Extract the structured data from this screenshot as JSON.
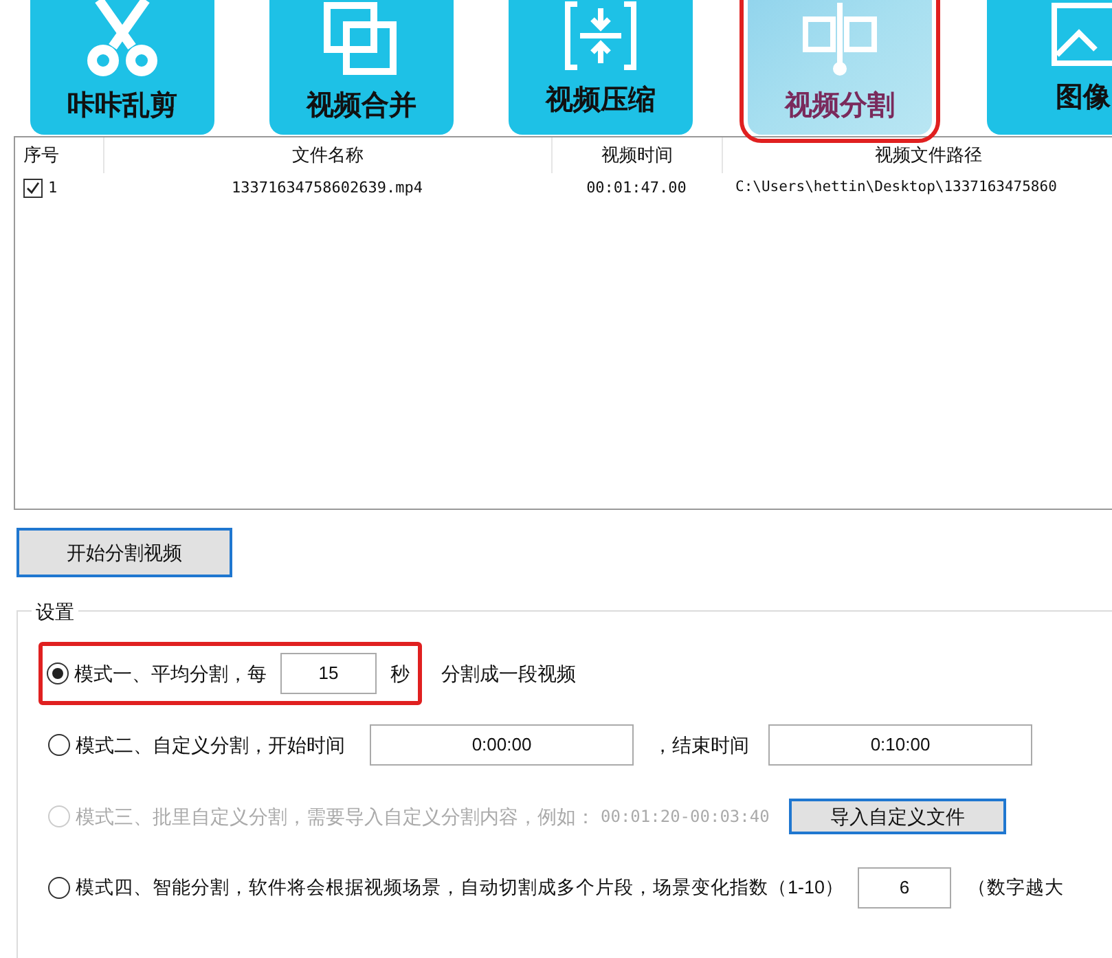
{
  "toolbar": [
    {
      "label": "咔咔乱剪",
      "kind": "scissors",
      "selected": false
    },
    {
      "label": "视频合并",
      "kind": "merge",
      "selected": false
    },
    {
      "label": "视频压缩",
      "kind": "compress",
      "selected": false
    },
    {
      "label": "视频分割",
      "kind": "split",
      "selected": true
    },
    {
      "label": "图像",
      "kind": "image",
      "selected": false
    }
  ],
  "table": {
    "columns": [
      "序号",
      "文件名称",
      "视频时间",
      "视频文件路径"
    ],
    "rows": [
      {
        "checked": true,
        "cells": [
          "1",
          "13371634758602639.mp4",
          "00:01:47.00",
          "C:\\Users\\hettin\\Desktop\\1337163475860"
        ]
      }
    ]
  },
  "start_button": "开始分割视频",
  "settings": {
    "title": "设置",
    "modes": [
      {
        "kind": "seconds",
        "selected": true,
        "disabled": false,
        "highlighted": true,
        "label": "模式一、平均分割，每",
        "value": "15",
        "unit": "秒",
        "suffix": "分割成一段视频"
      },
      {
        "kind": "range",
        "selected": false,
        "disabled": false,
        "highlighted": false,
        "label": "模式二、自定义分割，开始时间",
        "start": "0:00:00",
        "mid": "，结束时间",
        "end": "0:10:00"
      },
      {
        "kind": "import",
        "selected": false,
        "disabled": true,
        "highlighted": false,
        "label": "模式三、批里自定义分割，需要导入自定义分割内容，例如：",
        "example": "00:01:20-00:03:40",
        "button": "导入自定义文件"
      },
      {
        "kind": "smart",
        "selected": false,
        "disabled": false,
        "highlighted": false,
        "label": "模式四、智能分割，软件将会根据视频场景，自动切割成多个片段，场景变化指数（1-10）",
        "value": "6",
        "suffix": "（数字越大"
      }
    ]
  }
}
